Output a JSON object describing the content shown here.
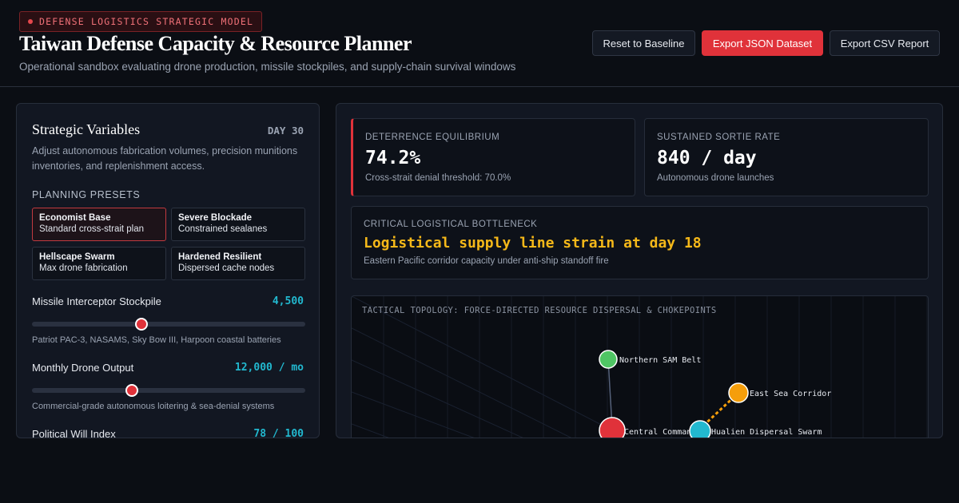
{
  "header": {
    "tag": "DEFENSE LOGISTICS STRATEGIC MODEL",
    "title": "Taiwan Defense Capacity & Resource Planner",
    "subtitle": "Operational sandbox evaluating drone production, missile stockpiles, and supply-chain survival windows",
    "buttons": {
      "reset": "Reset to Baseline",
      "export_json": "Export JSON Dataset",
      "export_csv": "Export CSV Report"
    }
  },
  "colors": {
    "accent": "#e0323a",
    "value_cyan": "#22b8cf",
    "warning": "#f5b819",
    "background": "#0b0e14"
  },
  "variables_panel": {
    "title": "Strategic Variables",
    "day": "DAY 30",
    "description": "Adjust autonomous fabrication volumes, precision munitions inventories, and replenishment access.",
    "presets_label": "PLANNING PRESETS",
    "presets": [
      {
        "name": "Economist Base",
        "desc": "Standard cross-strait plan",
        "active": true
      },
      {
        "name": "Severe Blockade",
        "desc": "Constrained sealanes",
        "active": false
      },
      {
        "name": "Hellscape Swarm",
        "desc": "Max drone fabrication",
        "active": false
      },
      {
        "name": "Hardened Resilient",
        "desc": "Dispersed cache nodes",
        "active": false
      }
    ],
    "variables": [
      {
        "label": "Missile Interceptor Stockpile",
        "value": "4,500",
        "level": 0.4,
        "note": "Patriot PAC-3, NASAMS, Sky Bow III, Harpoon coastal batteries"
      },
      {
        "label": "Monthly Drone Output",
        "value": "12,000 / mo",
        "level": 0.365,
        "note": "Commercial-grade autonomous loitering & sea-denial systems"
      },
      {
        "label": "Political Will Index",
        "value": "78 / 100",
        "level": 0.78,
        "note": ""
      }
    ]
  },
  "metrics": {
    "deterrence": {
      "label": "DETERRENCE EQUILIBRIUM",
      "value": "74.2%",
      "note": "Cross-strait denial threshold: 70.0%"
    },
    "sortie": {
      "label": "SUSTAINED SORTIE RATE",
      "value": "840 / day",
      "note": "Autonomous drone launches"
    },
    "bottleneck": {
      "label": "CRITICAL LOGISTICAL BOTTLENECK",
      "value": "Logistical supply line strain at day 18",
      "note": "Eastern Pacific corridor capacity under anti-ship standoff fire"
    }
  },
  "topology": {
    "label": "TACTICAL TOPOLOGY: FORCE-DIRECTED RESOURCE DISPERSAL & CHOKEPOINTS",
    "nodes": [
      {
        "name": "Northern SAM Belt",
        "color": "#4fc564"
      },
      {
        "name": "East Sea Corridor",
        "color": "#f59e0b"
      },
      {
        "name": "Central Command",
        "color": "#e0323a"
      },
      {
        "name": "Hualien Dispersal Swarm",
        "color": "#22b8cf"
      }
    ]
  }
}
